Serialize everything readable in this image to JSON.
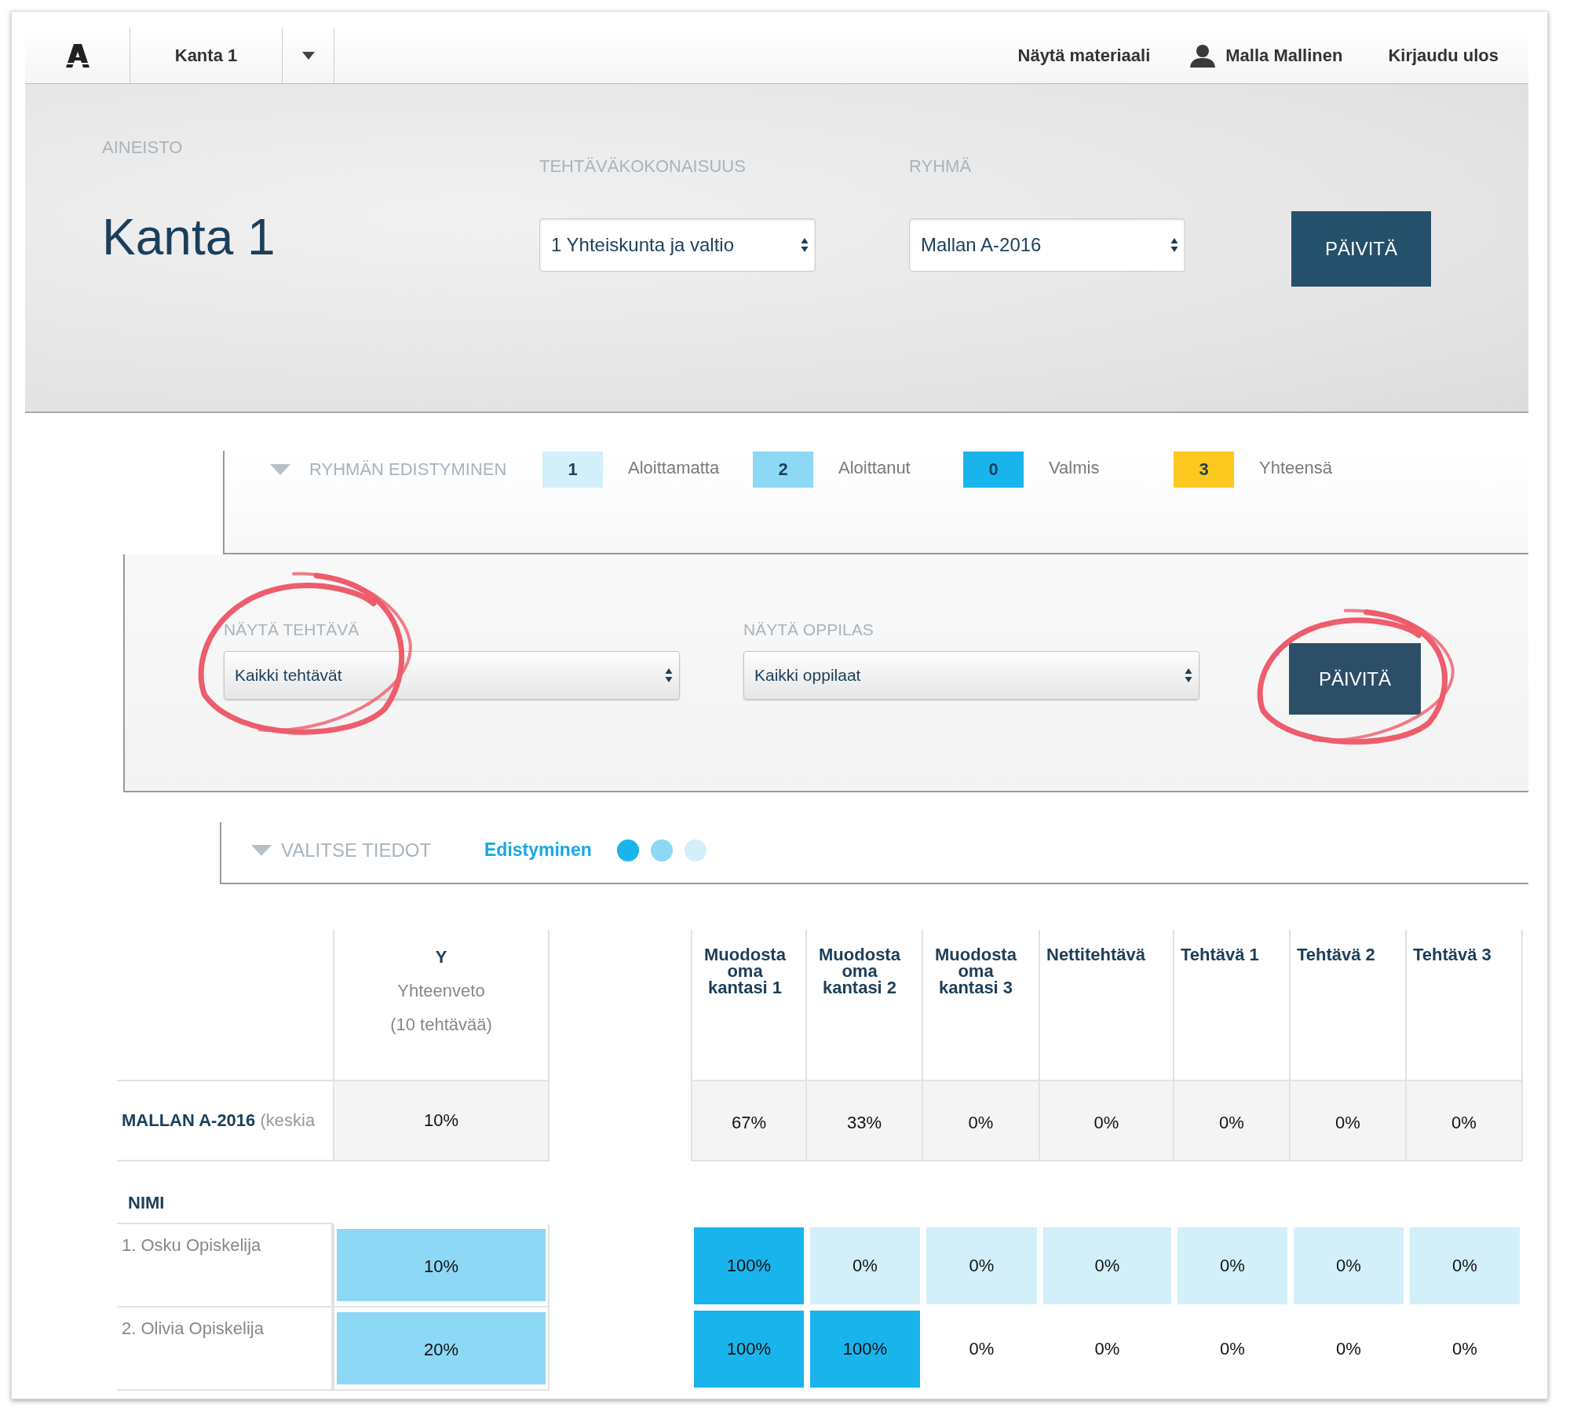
{
  "navbar": {
    "material": "Kanta 1",
    "links": [
      {
        "kind": "link",
        "label": "Näytä materiaali"
      },
      {
        "kind": "user",
        "label": "Malla Mallinen"
      },
      {
        "kind": "link",
        "label": "Kirjaudu ulos"
      }
    ]
  },
  "header": {
    "section_label": "AINEISTO",
    "title": "Kanta 1",
    "filters": [
      {
        "label": "TEHTÄVÄKOKONAISUUS",
        "value": "1 Yhteiskunta ja valtio"
      },
      {
        "label": "RYHMÄ",
        "value": "Mallan A-2016"
      }
    ],
    "button": "PÄIVITÄ"
  },
  "group_progress": {
    "title": "RYHMÄN EDISTYMINEN",
    "legend": [
      {
        "count": "1",
        "label": "Aloittamatta",
        "color": "#d2effa"
      },
      {
        "count": "2",
        "label": "Aloittanut",
        "color": "#8dd8f5"
      },
      {
        "count": "0",
        "label": "Valmis",
        "color": "#1ab4ec"
      },
      {
        "count": "3",
        "label": "Yhteensä",
        "color": "#fdc820"
      }
    ]
  },
  "filters": {
    "fields": [
      {
        "label": "NÄYTÄ TEHTÄVÄ",
        "value": "Kaikki tehtävät",
        "circled": true
      },
      {
        "label": "NÄYTÄ OPPILAS",
        "value": "Kaikki oppilaat",
        "circled": false
      }
    ],
    "button": {
      "label": "PÄIVITÄ",
      "circled": true
    }
  },
  "data_picker": {
    "title": "VALITSE TIEDOT",
    "option": "Edistyminen",
    "dots": [
      {
        "color": "#1ab4ec"
      },
      {
        "color": "#8dd8f5"
      },
      {
        "color": "#d2effa"
      }
    ]
  },
  "table": {
    "summary_column": {
      "letter": "Y",
      "title": "Yhteenveto",
      "count": "(10 tehtävää)"
    },
    "columns": [
      "Muodosta oma kantasi 1",
      "Muodosta oma kantasi 2",
      "Muodosta oma kantasi 3",
      "Nettitehtävä",
      "Tehtävä 1",
      "Tehtävä 2",
      "Tehtävä 3"
    ],
    "group_row": {
      "name": "**MALLAN A-2016** (keskia",
      "summary": "10%",
      "values": [
        "67%",
        "33%",
        "0%",
        "0%",
        "0%",
        "0%",
        "0%"
      ]
    },
    "name_heading": "NIMI",
    "rows": [
      {
        "name": "1. Osku Opiskelija",
        "summary": {
          "value": "10%",
          "color": "#8dd8f5"
        },
        "cells": [
          {
            "value": "100%",
            "color": "#1ab4ec"
          },
          {
            "value": "0%",
            "color": "#d2effa"
          },
          {
            "value": "0%",
            "color": "#d2effa"
          },
          {
            "value": "0%",
            "color": "#d2effa"
          },
          {
            "value": "0%",
            "color": "#d2effa"
          },
          {
            "value": "0%",
            "color": "#d2effa"
          },
          {
            "value": "0%",
            "color": "#d2effa"
          }
        ]
      },
      {
        "name": "2. Olivia Opiskelija",
        "summary": {
          "value": "20%",
          "color": "#8dd8f5"
        },
        "cells": [
          {
            "value": "100%",
            "color": "#1ab4ec"
          },
          {
            "value": "100%",
            "color": "#1ab4ec"
          },
          {
            "value": "0%"
          },
          {
            "value": "0%"
          },
          {
            "value": "0%"
          },
          {
            "value": "0%"
          },
          {
            "value": "0%"
          }
        ]
      }
    ]
  }
}
